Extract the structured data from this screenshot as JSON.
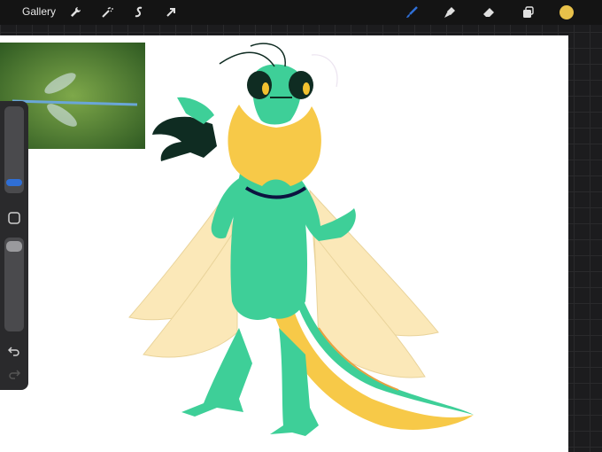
{
  "topbar": {
    "gallery_label": "Gallery",
    "left_tools": [
      "wrench-icon",
      "magic-wand-icon",
      "selection-icon",
      "transform-arrow-icon"
    ],
    "right_tools": [
      "brush-icon",
      "smudge-icon",
      "eraser-icon",
      "layers-icon",
      "color-swatch"
    ],
    "active_tool": "brush-icon",
    "brush_color": "#2f6fd6",
    "current_color": "#e8c14a"
  },
  "sidebar": {
    "brush_size_level": 0.3,
    "opacity_level": 0.95,
    "buttons": [
      "modify-button",
      "undo-icon",
      "redo-icon"
    ]
  },
  "palette": {
    "body": "#3ecf98",
    "body_dark": "#2fb582",
    "mane": "#f7c948",
    "wings": "#fbe8b8",
    "claws": "#0f2c22",
    "belt": "#0c1340",
    "eyes": "#f2c230"
  }
}
